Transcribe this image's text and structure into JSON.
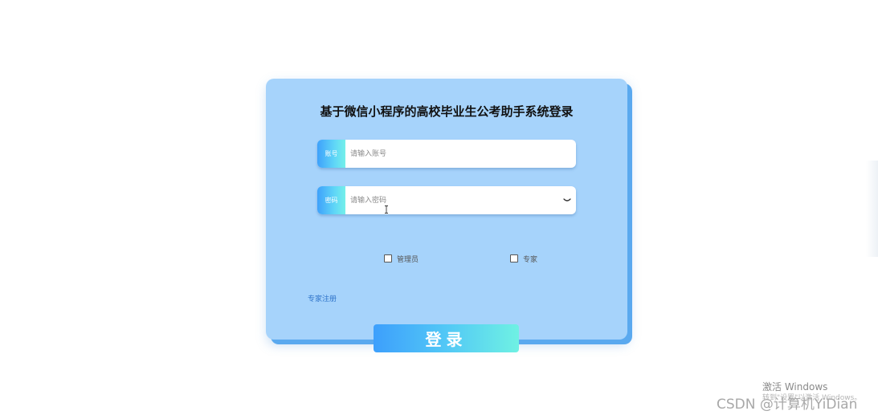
{
  "login": {
    "title": "基于微信小程序的高校毕业生公考助手系统登录",
    "account": {
      "prefix": "账号",
      "placeholder": "请输入账号"
    },
    "password": {
      "prefix": "密码",
      "placeholder": "请输入密码"
    },
    "roles": [
      {
        "label": "管理员",
        "checked": false
      },
      {
        "label": "专家",
        "checked": false
      }
    ],
    "register_link": "专家注册",
    "submit_label": "登录"
  },
  "os_overlay": {
    "activate_title": "激活 Windows",
    "activate_sub": "转到\"设置\"以激活 Windows。"
  },
  "watermark": "CSDN @计算机YiDian",
  "colors": {
    "card_background": "#a6d3fb",
    "card_shadow": "#5aa9ef",
    "gradient_start": "#3d9ffc",
    "gradient_end": "#6ff1e3",
    "link": "#2f74c9"
  },
  "icons": {
    "password_toggle": "eye-closed-icon",
    "text_cursor": "text-cursor-icon"
  }
}
